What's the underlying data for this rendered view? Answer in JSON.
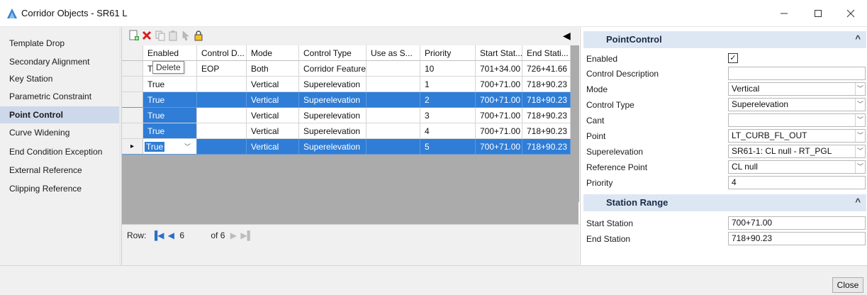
{
  "window": {
    "title": "Corridor Objects - SR61 L"
  },
  "nav": {
    "items": [
      {
        "label": "Template Drop"
      },
      {
        "label": "Secondary Alignment"
      },
      {
        "label": "Key Station"
      },
      {
        "label": "Parametric Constraint"
      },
      {
        "label": "Point Control"
      },
      {
        "label": "Curve Widening"
      },
      {
        "label": "End Condition Exception"
      },
      {
        "label": "External Reference"
      },
      {
        "label": "Clipping Reference"
      }
    ],
    "selected": "Point Control"
  },
  "toolbar": {
    "icons": [
      "add-icon",
      "delete-icon",
      "copy-icon",
      "paste-icon",
      "pick-icon",
      "lock-icon"
    ],
    "tooltip": "Delete"
  },
  "grid": {
    "columns": [
      "Enabled",
      "Control D...",
      "Mode",
      "Control Type",
      "Use as S...",
      "Priority",
      "Start Stat...",
      "End Stati..."
    ],
    "rows": [
      {
        "enabled": "Tr",
        "control_desc": "EOP",
        "mode": "Both",
        "control_type": "Corridor Feature",
        "use_as": "",
        "priority": "10",
        "start": "701+34.00",
        "end": "726+41.66"
      },
      {
        "enabled": "True",
        "control_desc": "",
        "mode": "Vertical",
        "control_type": "Superelevation",
        "use_as": "",
        "priority": "1",
        "start": "700+71.00",
        "end": "718+90.23"
      },
      {
        "enabled": "True",
        "control_desc": "",
        "mode": "Vertical",
        "control_type": "Superelevation",
        "use_as": "",
        "priority": "2",
        "start": "700+71.00",
        "end": "718+90.23"
      },
      {
        "enabled": "True",
        "control_desc": "",
        "mode": "Vertical",
        "control_type": "Superelevation",
        "use_as": "",
        "priority": "3",
        "start": "700+71.00",
        "end": "718+90.23"
      },
      {
        "enabled": "True",
        "control_desc": "",
        "mode": "Vertical",
        "control_type": "Superelevation",
        "use_as": "",
        "priority": "4",
        "start": "700+71.00",
        "end": "718+90.23"
      },
      {
        "enabled": "True",
        "control_desc": "",
        "mode": "Vertical",
        "control_type": "Superelevation",
        "use_as": "",
        "priority": "5",
        "start": "700+71.00",
        "end": "718+90.23"
      }
    ],
    "selected_rows": [
      2,
      5
    ],
    "current_row_marker": "▸"
  },
  "pager": {
    "label": "Row:",
    "current": "6",
    "of_text": "of 6"
  },
  "properties": {
    "point_control": {
      "header": "PointControl",
      "fields": [
        {
          "label": "Enabled",
          "value": "✓",
          "kind": "checkbox"
        },
        {
          "label": "Control Description",
          "value": "",
          "kind": "text"
        },
        {
          "label": "Mode",
          "value": "Vertical",
          "kind": "dropdown"
        },
        {
          "label": "Control Type",
          "value": "Superelevation",
          "kind": "dropdown"
        },
        {
          "label": "Cant",
          "value": "",
          "kind": "dropdown"
        },
        {
          "label": "Point",
          "value": "LT_CURB_FL_OUT",
          "kind": "dropdown"
        },
        {
          "label": "Superelevation",
          "value": "SR61-1: CL null - RT_PGL",
          "kind": "dropdown"
        },
        {
          "label": "Reference Point",
          "value": "CL null",
          "kind": "dropdown"
        },
        {
          "label": "Priority",
          "value": "4",
          "kind": "text"
        }
      ]
    },
    "station_range": {
      "header": "Station Range",
      "fields": [
        {
          "label": "Start Station",
          "value": "700+71.00"
        },
        {
          "label": "End Station",
          "value": "718+90.23"
        }
      ]
    }
  },
  "footer": {
    "close_label": "Close"
  },
  "colors": {
    "selection": "#2f7dd6",
    "section_header": "#dde7f4",
    "nav_selected": "#cdd9ea"
  }
}
